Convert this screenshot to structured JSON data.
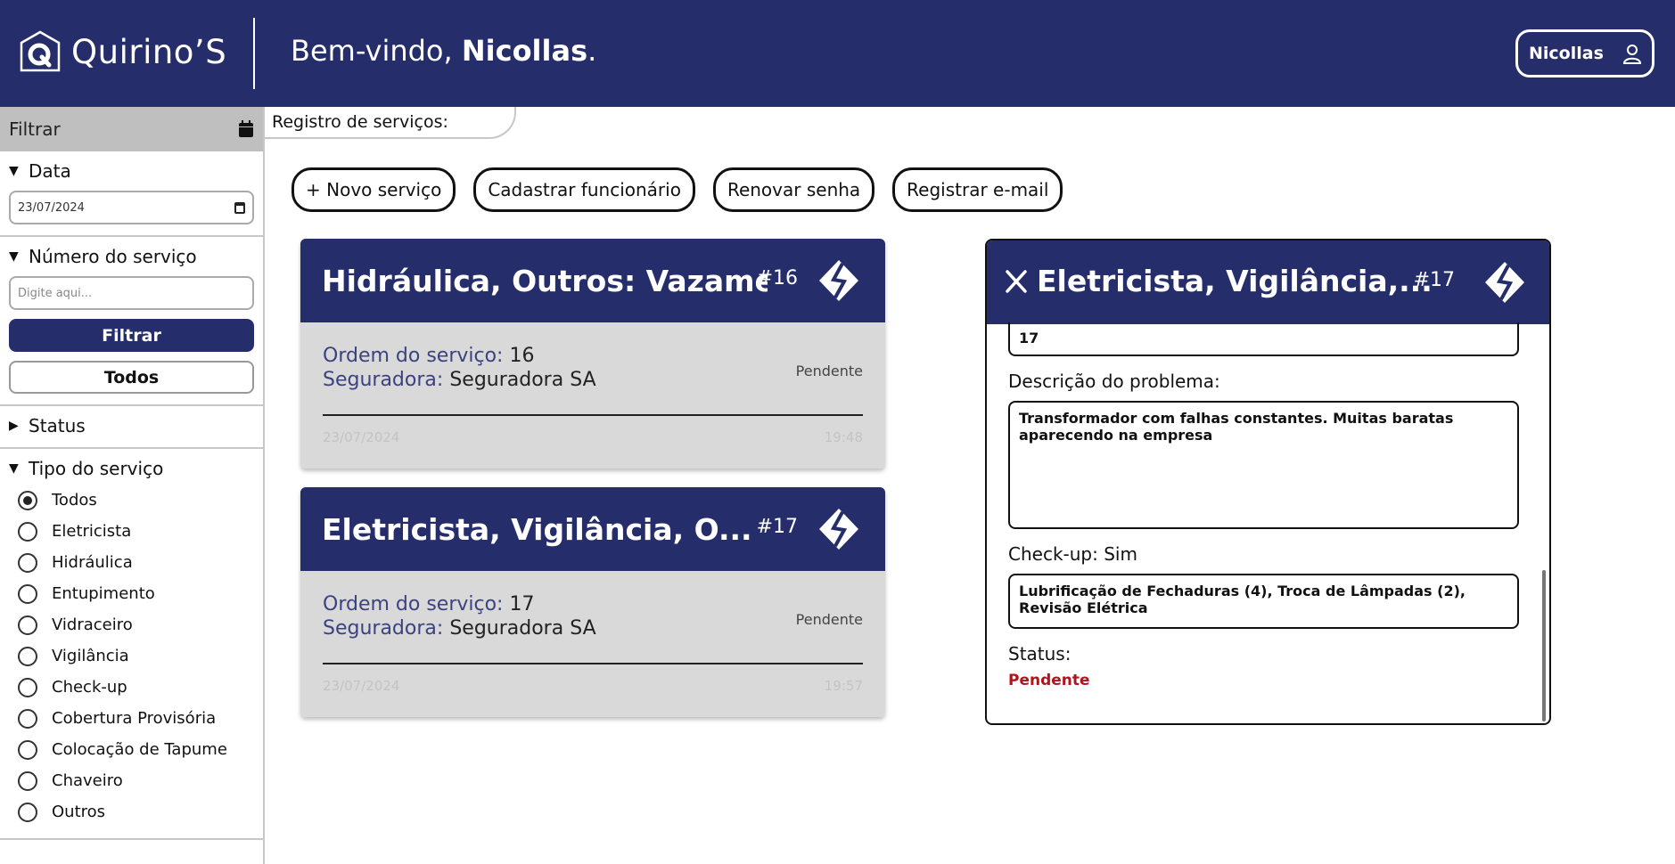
{
  "header": {
    "logo_text": "Quirino’S",
    "welcome_prefix": "Bem-vindo, ",
    "welcome_name": "Nicollas",
    "welcome_suffix": ".",
    "user_button": "Nicollas"
  },
  "sidebar": {
    "filter_title": "Filtrar",
    "date_section": "Data",
    "date_value": "23/07/2024",
    "number_section": "Número do serviço",
    "number_placeholder": "Digite aqui...",
    "filter_button": "Filtrar",
    "all_button": "Todos",
    "status_section": "Status",
    "type_section": "Tipo do serviço",
    "types": [
      "Todos",
      "Eletricista",
      "Hidráulica",
      "Entupimento",
      "Vidraceiro",
      "Vigilância",
      "Check-up",
      "Cobertura Provisória",
      "Colocação de Tapume",
      "Chaveiro",
      "Outros"
    ],
    "selected_type": "Todos"
  },
  "main": {
    "tab_title": "Registro de serviços:",
    "actions": [
      "+ Novo serviço",
      "Cadastrar funcionário",
      "Renovar senha",
      "Registrar e-mail"
    ],
    "cards": [
      {
        "title": "Hidráulica, Outros: Vazame...",
        "number": "#16",
        "order_label": "Ordem do serviço:",
        "order_value": "16",
        "insurer_label": "Seguradora:",
        "insurer_value": "Seguradora SA",
        "status": "Pendente",
        "date": "23/07/2024",
        "time": "19:48"
      },
      {
        "title": "Eletricista, Vigilância, O...",
        "number": "#17",
        "order_label": "Ordem do serviço:",
        "order_value": "17",
        "insurer_label": "Seguradora:",
        "insurer_value": "Seguradora SA",
        "status": "Pendente",
        "date": "23/07/2024",
        "time": "19:57"
      }
    ]
  },
  "detail": {
    "title": "Eletricista, Vigilância,...",
    "number": "#17",
    "order_value": "17",
    "description_label": "Descrição do problema:",
    "description": "Transformador com falhas constantes. Muitas baratas aparecendo na empresa",
    "checkup_label": "Check-up: Sim",
    "checkup_items": "Lubrificação de Fechaduras (4), Troca de Lâmpadas (2), Revisão Elétrica",
    "status_label": "Status:",
    "status_value": "Pendente",
    "status_color": "#b0141c"
  },
  "colors": {
    "brand": "#262d6b",
    "card_body": "#d9d9d9",
    "sidebar_header": "#bfbfbf"
  }
}
